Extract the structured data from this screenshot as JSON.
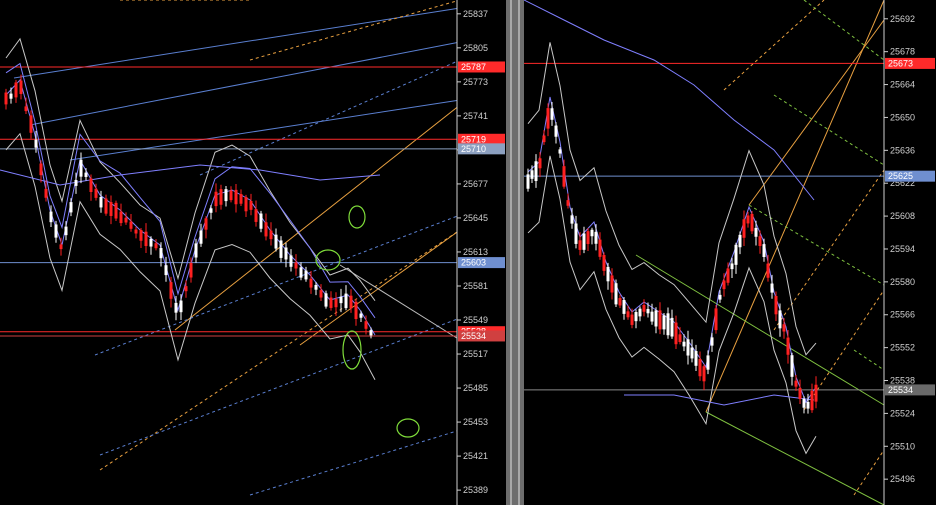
{
  "colors": {
    "background": "#000000",
    "bull_candle": "#ffffff",
    "bear_candle": "#ff2020",
    "support_resistance": "#ff2a2a",
    "horizontal_blue": "#6f8fd0",
    "bollinger": "#c8c8c8",
    "moving_average": "#7f7fff",
    "fib_channel_orange": "#e8a040",
    "fib_channel_green": "#7fc040",
    "annotation_circle": "#7fdc3a",
    "divider": "#6d6d6d"
  },
  "charts": [
    {
      "id": "left",
      "ylim": [
        25375,
        25850
      ],
      "price_ticks": [
        "25837",
        "25805",
        "25773",
        "25741",
        "25709",
        "25677",
        "25645",
        "25613",
        "25581",
        "25549",
        "25517",
        "25485",
        "25453",
        "25421",
        "25389"
      ],
      "price_tags": [
        {
          "label": "25787",
          "value": 25787,
          "color": "#ff2a2a"
        },
        {
          "label": "25719",
          "value": 25719,
          "color": "#ff2a2a"
        },
        {
          "label": "25710",
          "value": 25710,
          "color": "#8ca0c0"
        },
        {
          "label": "25603",
          "value": 25603,
          "color": "#6f8fd0"
        },
        {
          "label": "25538",
          "value": 25538,
          "color": "#ff2a2a"
        },
        {
          "label": "25534",
          "value": 25534,
          "color": "#d04040"
        }
      ],
      "annotations": [
        "circle",
        "circle",
        "circle",
        "circle"
      ]
    },
    {
      "id": "right",
      "ylim": [
        25485,
        25700
      ],
      "price_ticks": [
        "25692",
        "25678",
        "25664",
        "25650",
        "25636",
        "25622",
        "25608",
        "25594",
        "25580",
        "25566",
        "25552",
        "25538",
        "25524",
        "25510",
        "25496"
      ],
      "price_tags": [
        {
          "label": "25673",
          "value": 25673,
          "color": "#ff2a2a"
        },
        {
          "label": "25625",
          "value": 25625,
          "color": "#6f8fd0"
        },
        {
          "label": "25534",
          "value": 25534,
          "color": "#6a6a6a"
        }
      ]
    }
  ]
}
